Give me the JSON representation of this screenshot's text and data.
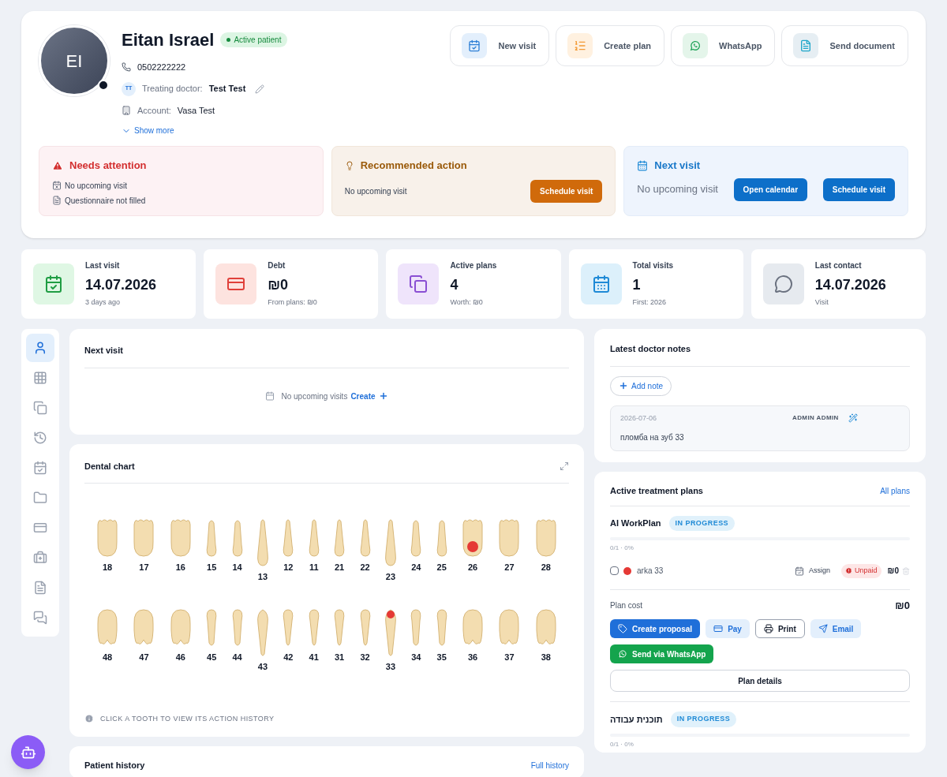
{
  "patient": {
    "initials": "EI",
    "name": "Eitan Israel",
    "status": "Active patient",
    "online": true,
    "phone": "0502222222",
    "doctor_initials": "TT",
    "doctor_label": "Treating doctor:",
    "doctor": "Test Test",
    "account_label": "Account:",
    "account": "Vasa Test",
    "show_more": "Show more"
  },
  "actions": [
    {
      "kind": "visit",
      "label": "New visit"
    },
    {
      "kind": "plan",
      "label": "Create plan"
    },
    {
      "kind": "whatsapp",
      "label": "WhatsApp"
    },
    {
      "kind": "document",
      "label": "Send document"
    }
  ],
  "alerts": {
    "attention": {
      "title": "Needs attention",
      "items": [
        {
          "kind": "calendar",
          "text": "No upcoming visit"
        },
        {
          "kind": "document",
          "text": "Questionnaire not filled"
        }
      ]
    },
    "recommended": {
      "title": "Recommended action",
      "text": "No upcoming visit",
      "button": "Schedule visit"
    },
    "next": {
      "title": "Next visit",
      "text": "No upcoming visit",
      "buttons": [
        "Open calendar",
        "Schedule visit"
      ]
    }
  },
  "stats": [
    {
      "kind": "visit",
      "label": "Last visit",
      "value": "14.07.2026",
      "sub": "3 days ago"
    },
    {
      "kind": "debt",
      "label": "Debt",
      "value": "₪0",
      "sub": "From plans: ₪0"
    },
    {
      "kind": "plans",
      "label": "Active plans",
      "value": "4",
      "sub": "Worth: ₪0"
    },
    {
      "kind": "total",
      "label": "Total visits",
      "value": "1",
      "sub": "First: 2026"
    },
    {
      "kind": "contact",
      "label": "Last contact",
      "value": "14.07.2026",
      "sub": "Visit"
    }
  ],
  "sidebar": [
    {
      "kind": "user",
      "selected": true
    },
    {
      "kind": "grid",
      "selected": false
    },
    {
      "kind": "copy",
      "selected": false
    },
    {
      "kind": "history",
      "selected": false
    },
    {
      "kind": "calendar",
      "selected": false
    },
    {
      "kind": "folder",
      "selected": false
    },
    {
      "kind": "card",
      "selected": false
    },
    {
      "kind": "kit",
      "selected": false
    },
    {
      "kind": "file",
      "selected": false
    },
    {
      "kind": "chat",
      "selected": false
    }
  ],
  "next_visit": {
    "title": "Next visit",
    "empty": "No upcoming visits",
    "create": "Create"
  },
  "dental_chart": {
    "title": "Dental chart",
    "hint": "CLICK A TOOTH TO VIEW ITS ACTION HISTORY",
    "upper": [
      {
        "number": "18",
        "kind": "molar",
        "marked": false
      },
      {
        "number": "17",
        "kind": "molar",
        "marked": false
      },
      {
        "number": "16",
        "kind": "molar",
        "marked": false
      },
      {
        "number": "15",
        "kind": "premolar",
        "marked": false
      },
      {
        "number": "14",
        "kind": "premolar",
        "marked": false
      },
      {
        "number": "13",
        "kind": "canine",
        "marked": false
      },
      {
        "number": "12",
        "kind": "incisor",
        "marked": false
      },
      {
        "number": "11",
        "kind": "incisor",
        "marked": false
      },
      {
        "number": "21",
        "kind": "incisor",
        "marked": false
      },
      {
        "number": "22",
        "kind": "incisor",
        "marked": false
      },
      {
        "number": "23",
        "kind": "canine",
        "marked": false
      },
      {
        "number": "24",
        "kind": "premolar",
        "marked": false
      },
      {
        "number": "25",
        "kind": "premolar",
        "marked": false
      },
      {
        "number": "26",
        "kind": "molar",
        "marked": true
      },
      {
        "number": "27",
        "kind": "molar",
        "marked": false
      },
      {
        "number": "28",
        "kind": "molar",
        "marked": false
      }
    ],
    "lower": [
      {
        "number": "48",
        "kind": "molar",
        "marked": false
      },
      {
        "number": "47",
        "kind": "molar",
        "marked": false
      },
      {
        "number": "46",
        "kind": "molar",
        "marked": false
      },
      {
        "number": "45",
        "kind": "premolar",
        "marked": false
      },
      {
        "number": "44",
        "kind": "premolar",
        "marked": false
      },
      {
        "number": "43",
        "kind": "canine",
        "marked": false
      },
      {
        "number": "42",
        "kind": "incisor",
        "marked": false
      },
      {
        "number": "41",
        "kind": "incisor",
        "marked": false
      },
      {
        "number": "31",
        "kind": "incisor",
        "marked": false
      },
      {
        "number": "32",
        "kind": "incisor",
        "marked": false
      },
      {
        "number": "33",
        "kind": "canine",
        "marked": true
      },
      {
        "number": "34",
        "kind": "premolar",
        "marked": false
      },
      {
        "number": "35",
        "kind": "premolar",
        "marked": false
      },
      {
        "number": "36",
        "kind": "molar",
        "marked": false
      },
      {
        "number": "37",
        "kind": "molar",
        "marked": false
      },
      {
        "number": "38",
        "kind": "molar",
        "marked": false
      }
    ]
  },
  "history": {
    "title": "Patient history",
    "link": "Full history"
  },
  "notes": {
    "title": "Latest doctor notes",
    "add": "Add note",
    "items": [
      {
        "date": "2026-07-06",
        "author": "ADMIN ADMIN",
        "text": "пломба на зуб 33"
      }
    ]
  },
  "plans": {
    "title": "Active treatment plans",
    "link": "All plans",
    "items": [
      {
        "name": "AI WorkPlan",
        "status": "IN PROGRESS",
        "level": 0,
        "progress": "0/1 · 0%",
        "rows": [
          {
            "checked": false,
            "color": "#e53935",
            "name": "arka 33",
            "assign": "Assign",
            "payment": "Unpaid",
            "price": "₪0"
          }
        ],
        "cost_label": "Plan cost",
        "cost": "₪0",
        "buttons": [
          {
            "kind": "proposal",
            "label": "Create proposal"
          },
          {
            "kind": "pay",
            "label": "Pay"
          },
          {
            "kind": "print",
            "label": "Print"
          },
          {
            "kind": "email",
            "label": "Email"
          },
          {
            "kind": "whatsapp",
            "label": "Send via WhatsApp"
          }
        ],
        "details": "Plan details"
      },
      {
        "name": "תוכנית עבודה",
        "status": "IN PROGRESS",
        "level": 0,
        "progress": "0/1 · 0%"
      }
    ]
  }
}
